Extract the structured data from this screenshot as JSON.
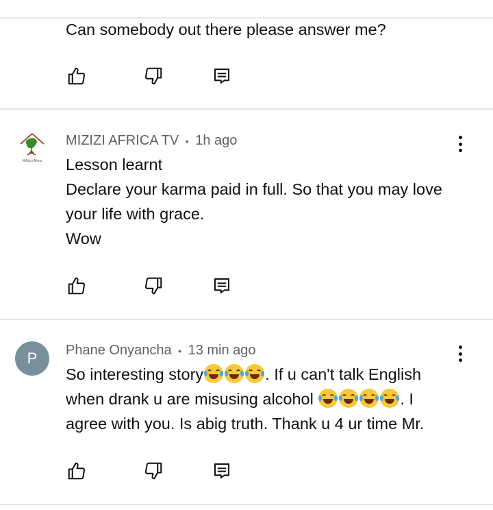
{
  "comments": [
    {
      "text_lines": [
        "Can somebody out there please answer me?"
      ]
    },
    {
      "author": "MIZIZI AFRICA TV",
      "time": "1h ago",
      "logo_caption": "#Mizizi Africa",
      "text_lines": [
        "Lesson learnt",
        "Declare your karma paid in full. So that you may love",
        "your life with grace.",
        "Wow"
      ]
    },
    {
      "author": "Phane Onyancha",
      "time": "13 min ago",
      "avatar_letter": "P",
      "avatar_color": "#78909c",
      "line1_a": "So interesting story",
      "line1_b": ". If u can't talk English",
      "line2_a": "when drank u are misusing alcohol ",
      "line2_b": ". I",
      "line3": "agree with you. Is abig truth. Thank u 4 ur time Mr."
    }
  ],
  "meta_separator": "•",
  "icons": {
    "like": "thumb-up-icon",
    "dislike": "thumb-down-icon",
    "reply": "reply-icon",
    "more": "more-vert-icon",
    "emoji_laugh": "tears-of-joy-emoji",
    "emoji_cry": "loudly-crying-emoji"
  }
}
